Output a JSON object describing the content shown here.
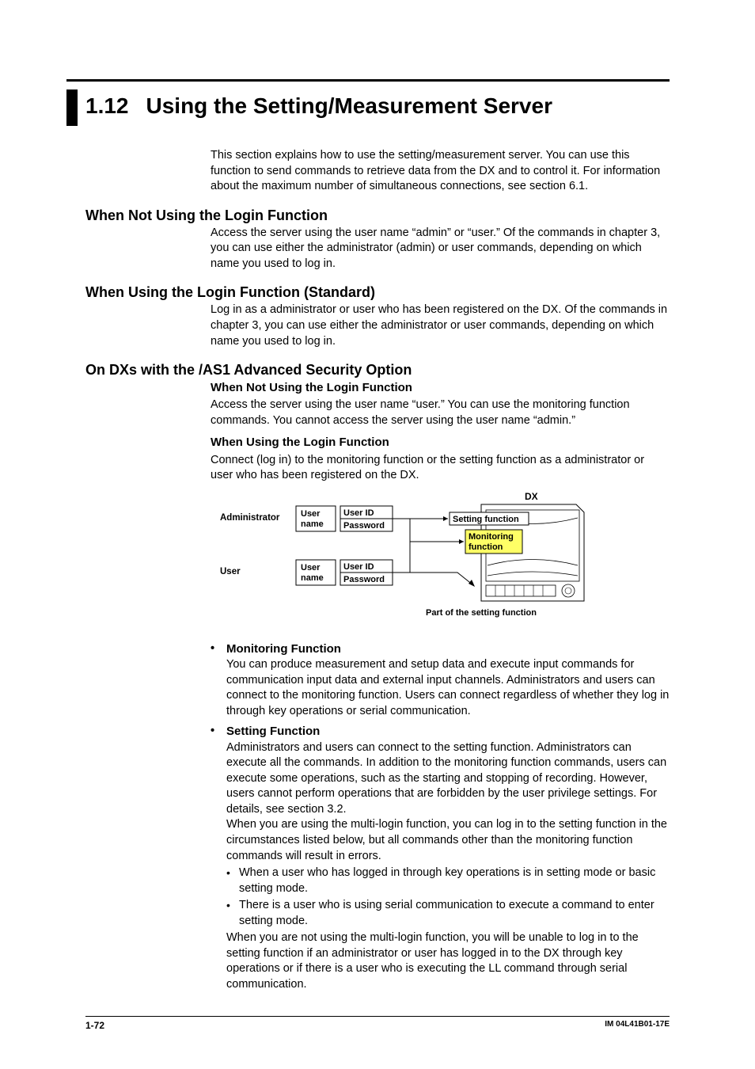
{
  "section_number": "1.12",
  "section_title": "Using the Setting/Measurement Server",
  "intro": "This section explains how to use the setting/measurement server. You can use this function to send commands to retrieve data from the DX and to control it. For information about the maximum number of simultaneous connections, see section 6.1.",
  "h2_1": "When Not Using the Login Function",
  "p_1": "Access the server using the user name “admin” or “user.” Of the commands in chapter 3, you can use either the administrator (admin) or user commands, depending on which name you used to log in.",
  "h2_2": "When Using the Login Function (Standard)",
  "p_2": "Log in as a administrator or user who has been registered on the DX. Of the commands in chapter 3, you can use either the administrator or user commands, depending on which name you used to log in.",
  "h2_3": "On DXs with the /AS1 Advanced Security Option",
  "h3_1": "When Not Using the Login Function",
  "p_3": "Access the server using the user name “user.” You can use the monitoring function commands. You cannot access the server using the user name “admin.”",
  "h3_2": "When Using the Login Function",
  "p_4": "Connect (log in) to the monitoring function or the setting function as a administrator or user who has been registered on the DX.",
  "diagram": {
    "dx_label": "DX",
    "admin_label": "Administrator",
    "user_label": "User",
    "user_name": "User name",
    "user_id": "User ID",
    "password": "Password",
    "setting_fn": "Setting function",
    "monitoring_fn": "Monitoring function",
    "caption": "Part of the setting function"
  },
  "bullet1_title": "Monitoring Function",
  "bullet1_body": "You can produce measurement and setup data and execute input commands for communication input data and external input channels. Administrators and users can connect to the monitoring function. Users can connect regardless of whether they log in through key operations or serial communication.",
  "bullet2_title": "Setting Function",
  "bullet2_body1": "Administrators and users can connect to the setting function. Administrators can execute all the commands. In addition to the monitoring function commands, users can execute some operations, such as the starting and stopping of recording. However, users cannot perform operations that are forbidden by the user privilege settings. For details, see section 3.2.",
  "bullet2_body2": "When you are using the multi-login function, you can log in to the setting function in the circumstances listed below, but all commands other than the monitoring function commands will result in errors.",
  "sub1": "When a user who has logged in through key operations is in setting mode or basic setting mode.",
  "sub2": "There is a user who is using serial communication to execute a command to enter setting mode.",
  "bullet2_body3": "When you are not using the multi-login function, you will be unable to log in to the setting function if an administrator or user has logged in to the DX through key operations or if there is a user who is executing the LL command through serial communication.",
  "page_number": "1-72",
  "doc_id": "IM 04L41B01-17E"
}
